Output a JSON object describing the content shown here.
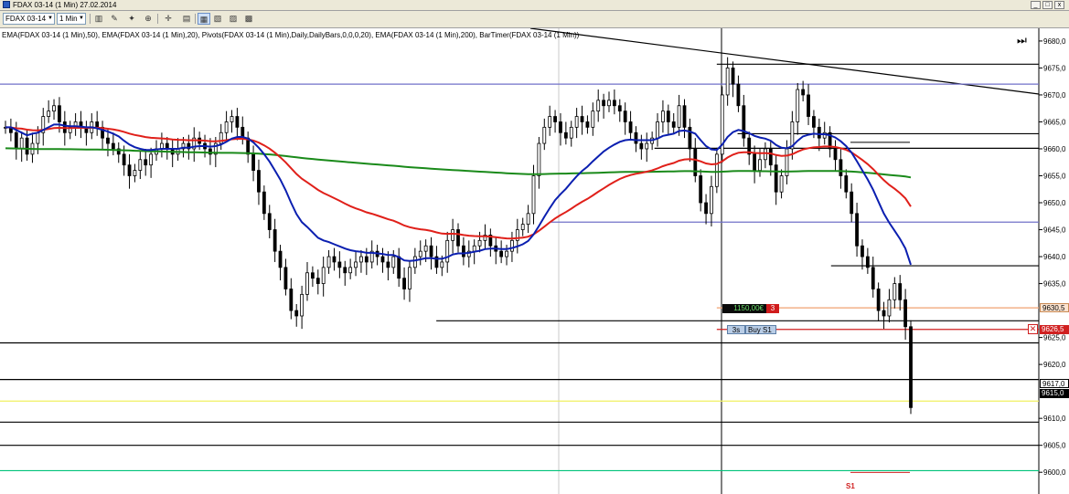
{
  "window": {
    "title": "FDAX 03-14 (1 Min)  27.02.2014",
    "buttons": [
      "_",
      "□",
      "x"
    ]
  },
  "toolbar": {
    "instrument": "FDAX 03-14",
    "interval": "1 Min",
    "icons": [
      "bar-chart-icon",
      "pencil-icon",
      "magic-wand-icon",
      "zoom-icon",
      "crosshair-icon",
      "properties-icon",
      "order-entry-icon",
      "indicators-icon",
      "image-icon",
      "template-icon"
    ]
  },
  "indicators_text": "EMA(FDAX 03-14 (1 Min),50),  EMA(FDAX 03-14 (1 Min),20),  Pivots(FDAX 03-14 (1 Min),Daily,DailyBars,0,0,0,20),  EMA(FDAX 03-14 (1 Min),200),  BarTimer(FDAX 03-14 (1 Min))",
  "price_labels": {
    "target": "9630,5",
    "stop": "9626,5",
    "current": "9615,0",
    "last": "9617,0"
  },
  "order": {
    "pnl": "1150,00€",
    "quantity": "3",
    "timer": "3s",
    "type": "Buy S1"
  },
  "pivot_label": "S1",
  "colors": {
    "ema20": "#0b1fb0",
    "ema50": "#e0201a",
    "ema200": "#1a8a1a",
    "candles": "#000000",
    "pivot_s1": "#00c27a",
    "yellow_line": "#f0f060",
    "blue_line": "#7070c8",
    "stop_line": "#d02020",
    "target_line": "#f0a070"
  },
  "chart_data": {
    "type": "candlestick",
    "title": "FDAX 03-14 (1 Min)",
    "ylim": [
      9598,
      9681
    ],
    "y_ticks": [
      "9680,0",
      "9675,0",
      "9670,0",
      "9665,0",
      "9660,0",
      "9655,0",
      "9650,0",
      "9645,0",
      "9640,0",
      "9635,0",
      "9625,0",
      "9620,0",
      "9610,0",
      "9605,0",
      "9600,0"
    ],
    "horizontal_lines": [
      {
        "price": 9675.7,
        "color": "#000000",
        "x_from": 0.69
      },
      {
        "price": 9672.0,
        "color": "#7070c8",
        "x_from": 0.0
      },
      {
        "price": 9662.8,
        "color": "#000000",
        "x_from": 0.71
      },
      {
        "price": 9660.1,
        "color": "#000000",
        "x_from": 0.63
      },
      {
        "price": 9646.4,
        "color": "#7070c8",
        "x_from": 0.53
      },
      {
        "price": 9638.3,
        "color": "#000000",
        "x_from": 0.8
      },
      {
        "price": 9630.5,
        "color": "#f0a070",
        "x_from": 0.69
      },
      {
        "price": 9628.1,
        "color": "#000000",
        "x_from": 0.42
      },
      {
        "price": 9626.5,
        "color": "#d02020",
        "x_from": 0.69
      },
      {
        "price": 9624.0,
        "color": "#000000",
        "x_from": 0.0
      },
      {
        "price": 9617.2,
        "color": "#000000",
        "x_from": 0.0
      },
      {
        "price": 9613.2,
        "color": "#f0f060",
        "x_from": 0.0
      },
      {
        "price": 9609.3,
        "color": "#000000",
        "x_from": 0.0
      },
      {
        "price": 9605.0,
        "color": "#000000",
        "x_from": 0.0
      },
      {
        "price": 9600.3,
        "color": "#00c27a",
        "x_from": 0.0
      }
    ],
    "candle_closes": [
      9664,
      9663,
      9660,
      9662,
      9659,
      9661,
      9663,
      9666,
      9667,
      9668,
      9665,
      9663,
      9664,
      9665,
      9664,
      9663,
      9665,
      9664,
      9662,
      9661,
      9660,
      9659,
      9657,
      9655,
      9656,
      9658,
      9657,
      9659,
      9660,
      9661,
      9660,
      9659,
      9660,
      9661,
      9660,
      9662,
      9661,
      9660,
      9659,
      9661,
      9663,
      9665,
      9666,
      9664,
      9662,
      9659,
      9656,
      9652,
      9648,
      9645,
      9641,
      9638,
      9634,
      9630,
      9629,
      9633,
      9637,
      9636,
      9635,
      9638,
      9640,
      9639,
      9638,
      9637,
      9638,
      9639,
      9640,
      9639,
      9641,
      9640,
      9639,
      9638,
      9640,
      9636,
      9634,
      9638,
      9640,
      9641,
      9642,
      9640,
      9638,
      9639,
      9643,
      9645,
      9642,
      9640,
      9641,
      9642,
      9643,
      9644,
      9642,
      9641,
      9640,
      9641,
      9643,
      9645,
      9646,
      9648,
      9655,
      9661,
      9664,
      9666,
      9665,
      9663,
      9662,
      9664,
      9666,
      9665,
      9664,
      9667,
      9669,
      9668,
      9669,
      9668,
      9667,
      9665,
      9663,
      9661,
      9660,
      9661,
      9662,
      9665,
      9667,
      9665,
      9664,
      9668,
      9664,
      9660,
      9655,
      9650,
      9648,
      9653,
      9659,
      9670,
      9675,
      9672,
      9668,
      9662,
      9659,
      9656,
      9658,
      9660,
      9657,
      9652,
      9655,
      9660,
      9665,
      9671,
      9670,
      9666,
      9664,
      9662,
      9663,
      9660,
      9658,
      9655,
      9652,
      9648,
      9642,
      9640,
      9638,
      9634,
      9630,
      9629,
      9632,
      9635,
      9632,
      9627,
      9612
    ],
    "ema20": [
      9664,
      9664,
      9663.5,
      9663,
      9662.5,
      9662.8,
      9663,
      9663.5,
      9664,
      9664.5,
      9664.5,
      9664.3,
      9664.2,
      9664.2,
      9664.1,
      9664,
      9664,
      9663.8,
      9663.5,
      9663.2,
      9662.8,
      9662.3,
      9661.5,
      9660.8,
      9660.3,
      9660,
      9659.8,
      9659.8,
      9659.9,
      9660,
      9660,
      9660,
      9660,
      9660.2,
      9660.2,
      9660.4,
      9660.5,
      9660.5,
      9660.4,
      9660.5,
      9660.8,
      9661.3,
      9661.9,
      9662.2,
      9662.2,
      9661.9,
      9661.2,
      9660.2,
      9659,
      9657.6,
      9656,
      9654.3,
      9652.3,
      9650,
      9647.9,
      9646.4,
      9645.5,
      9644.5,
      9643.5,
      9643,
      9642.7,
      9642.3,
      9641.9,
      9641.5,
      9641.2,
      9641,
      9640.9,
      9640.7,
      9640.7,
      9640.6,
      9640.5,
      9640.3,
      9640.3,
      9639.9,
      9639.3,
      9639.2,
      9639.3,
      9639.5,
      9639.7,
      9639.7,
      9639.6,
      9639.6,
      9639.9,
      9640.4,
      9640.6,
      9640.6,
      9640.7,
      9640.9,
      9641.1,
      9641.4,
      9641.5,
      9641.5,
      9641.4,
      9641.4,
      9641.6,
      9641.9,
      9642.3,
      9642.9,
      9644.1,
      9645.7,
      9647.4,
      9649,
      9650.5,
      9651.6,
      9652.6,
      9653.8,
      9654.9,
      9655.9,
      9656.7,
      9657.7,
      9658.6,
      9659.5,
      9660.2,
      9660.8,
      9661.3,
      9661.6,
      9661.7,
      9661.6,
      9661.6,
      9661.6,
      9661.6,
      9661.9,
      9662.4,
      9662.6,
      9662.8,
      9663.3,
      9663.4,
      9663.2,
      9662.8,
      9661.6,
      9660.5,
      9659.9,
      9659.8,
      9660.8,
      9662.2,
      9663.1,
      9663.5,
      9663.3,
      9662.9,
      9662.4,
      9662.1,
      9661.9,
      9661.5,
      9660.7,
      9660.2,
      9660.1,
      9660.5,
      9661.5,
      9662.3,
      9662.6,
      9662.8,
      9662.7,
      9662.7,
      9662.5,
      9662.1,
      9661.4,
      9660.5,
      9659.3,
      9657.7,
      9656,
      9654.3,
      9652.4,
      9650.2,
      9648,
      9646.3,
      9644.8,
      9643.3,
      9641.5,
      9638.5
    ]
  }
}
